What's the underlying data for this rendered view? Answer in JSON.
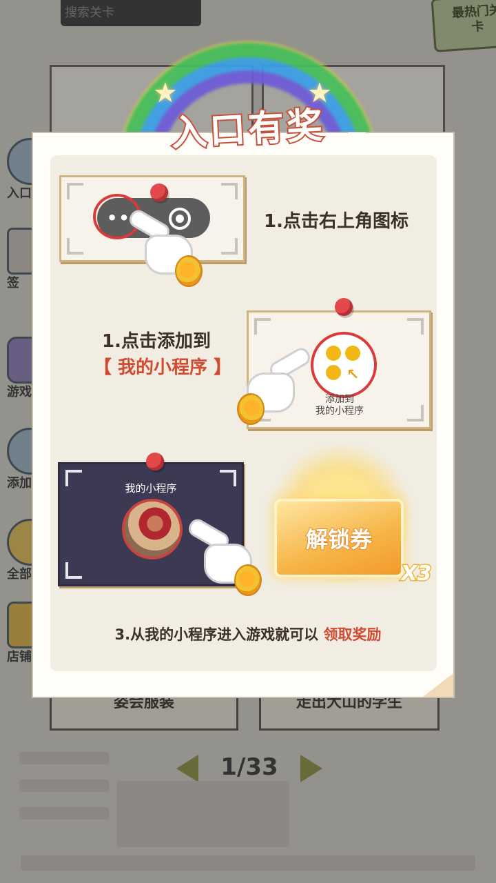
{
  "background": {
    "search_placeholder": "搜索关卡",
    "hot_badge": "最热门关卡",
    "side_items": [
      "入口",
      "签",
      "游戏",
      "添加",
      "全部",
      "店铺"
    ],
    "card_labels": [
      "姿会服装",
      "走出大山的学生"
    ],
    "pager": "1/33"
  },
  "modal": {
    "title": "入口有奖",
    "step1": "1.点击右上角图标",
    "step2_line1": "1.点击添加到",
    "step2_line2": "【 我的小程序 】",
    "step2_icon_label": "添加到\n我的小程序",
    "step3_card_title": "我的小程序",
    "ticket_label": "解锁券",
    "ticket_count": "X3",
    "bottom_prefix": "3.从我的小程序进入游戏就可以",
    "bottom_accent": "领取奖励"
  },
  "colors": {
    "accent_red": "#d24a30",
    "card_border": "#d2b27c",
    "dark_card": "#3c3953"
  }
}
